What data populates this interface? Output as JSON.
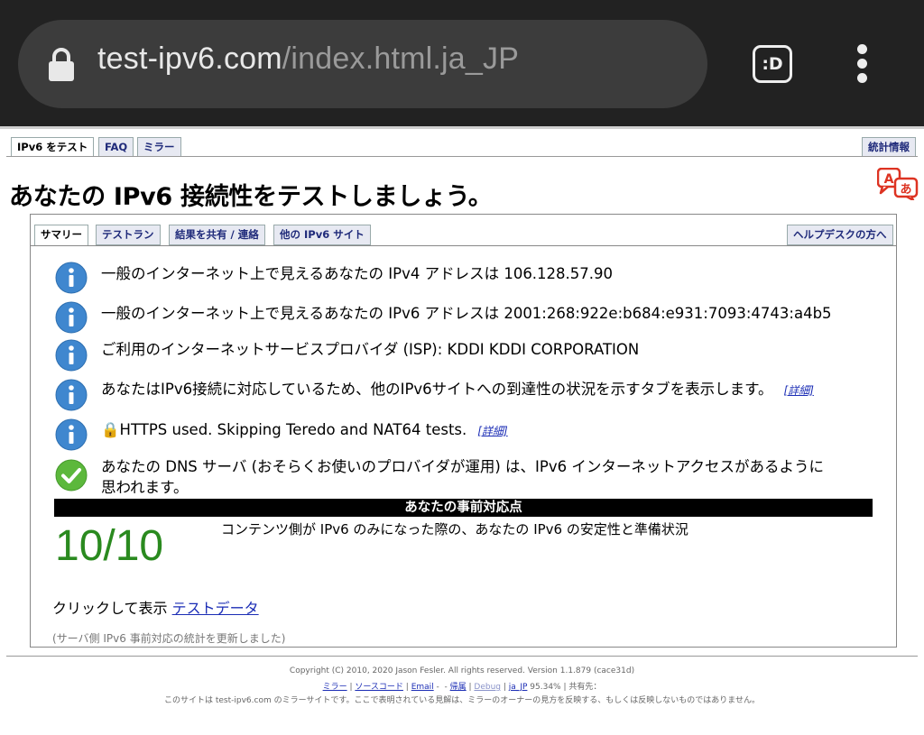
{
  "browser": {
    "url_host": "test-ipv6.com",
    "url_path": "/index.html.ja_JP",
    "ext_label": ":D"
  },
  "top_tabs": {
    "test": "IPv6 をテスト",
    "faq": "FAQ",
    "mirror": "ミラー",
    "stats": "統計情報"
  },
  "title": "あなたの IPv6 接続性をテストしましょう。",
  "sub_tabs": {
    "summary": "サマリー",
    "testrun": "テストラン",
    "share": "結果を共有 / 連絡",
    "other_sites": "他の IPv6 サイト",
    "helpdesk": "ヘルプデスクの方へ"
  },
  "results": [
    "一般のインターネット上で見えるあなたの IPv4 アドレスは 106.128.57.90",
    "一般のインターネット上で見えるあなたの IPv6 アドレスは 2001:268:922e:b684:e931:7093:4743:a4b5",
    "ご利用のインターネットサービスプロバイダ (ISP): KDDI KDDI CORPORATION",
    "あなたはIPv6接続に対応しているため、他のIPv6サイトへの到達性の状況を示すタブを表示します。",
    "HTTPS used. Skipping Teredo and NAT64 tests.",
    "あなたの DNS サーバ (おそらくお使いのプロバイダが運用) は、IPv6 インターネットアクセスがあるように",
    "思われます。"
  ],
  "more_link": "[詳細]",
  "lock_emoji": "🔒",
  "score": {
    "header": "あなたの事前対応点",
    "value": "10/10",
    "description": "コンテンツ側が IPv6 のみになった際の、あなたの IPv6 の安定性と準備状況"
  },
  "click_prefix": "クリックして表示",
  "click_link": "テストデータ",
  "updated_note": "(サーバ側 IPv6 事前対応の統計を更新しました)",
  "footer": {
    "copyright": "Copyright (C) 2010, 2020 Jason Fesler. All rights reserved. Version 1.1.879 (cace31d)",
    "mirror": "ミラー",
    "source": "ソースコード",
    "email": "Email",
    "attrib": "帰属",
    "debug": "Debug",
    "locale": "ja_JP",
    "percent": "95.34%",
    "sharer": "共有先：",
    "disclaimer": "このサイトは test-ipv6.com のミラーサイトです。ここで表明されている見解は、ミラーのオーナーの見方を反映する、もしくは反映しないものではありません。"
  },
  "colors": {
    "info_icon": "#3f87cf",
    "check_icon": "#5cb83c",
    "score": "#2a8a1f",
    "link": "#1b2db5"
  }
}
